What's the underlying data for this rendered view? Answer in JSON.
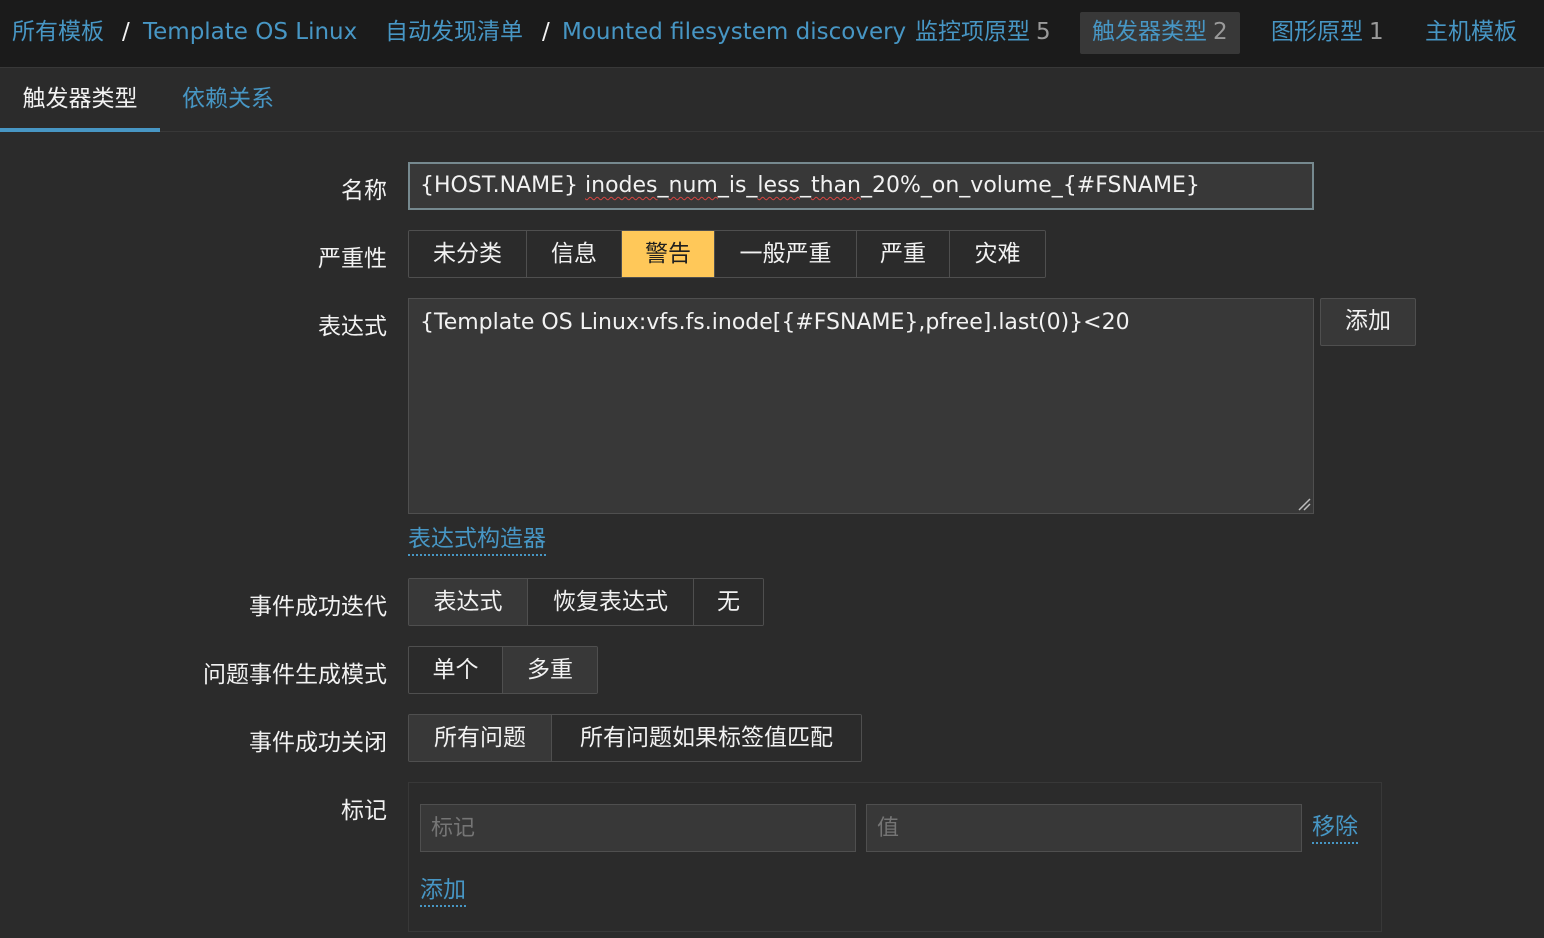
{
  "breadcrumb": {
    "all_templates": "所有模板",
    "sep1": "/",
    "template": "Template OS Linux",
    "discovery_list": "自动发现清单",
    "sep2": "/",
    "discovery_rule": "Mounted filesystem discovery",
    "item_prototypes": "监控项原型",
    "item_prototypes_count": "5",
    "trigger_prototypes": "触发器类型",
    "trigger_prototypes_count": "2",
    "graph_prototypes": "图形原型",
    "graph_prototypes_count": "1",
    "host_templates": "主机模板"
  },
  "tabs": [
    {
      "label": "触发器类型",
      "active": true
    },
    {
      "label": "依赖关系",
      "active": false
    }
  ],
  "form": {
    "name_label": "名称",
    "name_value_prefix": "{HOST.NAME}",
    "name_value_words": [
      " ",
      "inodes",
      "_",
      "num",
      "_",
      "is",
      "_",
      "less",
      "_",
      "than",
      "_20%_on_volume_{#FSNAME}"
    ],
    "severity_label": "严重性",
    "severity_options": [
      "未分类",
      "信息",
      "警告",
      "一般严重",
      "严重",
      "灾难"
    ],
    "severity_selected": "警告",
    "expression_label": "表达式",
    "expression_value": "{Template OS Linux:vfs.fs.inode[{#FSNAME},pfree].last(0)}<20",
    "add_button": "添加",
    "expression_builder_link": "表达式构造器",
    "ok_event_gen_label": "事件成功迭代",
    "ok_event_gen_options": [
      "表达式",
      "恢复表达式",
      "无"
    ],
    "ok_event_gen_selected": "表达式",
    "problem_event_mode_label": "问题事件生成模式",
    "problem_event_mode_options": [
      "单个",
      "多重"
    ],
    "problem_event_mode_selected": "多重",
    "ok_event_close_label": "事件成功关闭",
    "ok_event_close_options": [
      "所有问题",
      "所有问题如果标签值匹配"
    ],
    "ok_event_close_selected": "所有问题",
    "tags_label": "标记",
    "tag_placeholder": "标记",
    "value_placeholder": "值",
    "remove_link": "移除",
    "add_tag_link": "添加"
  },
  "colors": {
    "background": "#2b2b2b",
    "topbar": "#1b1b1b",
    "link": "#4796c4",
    "warning": "#ffc859",
    "input_bg": "#383838"
  }
}
